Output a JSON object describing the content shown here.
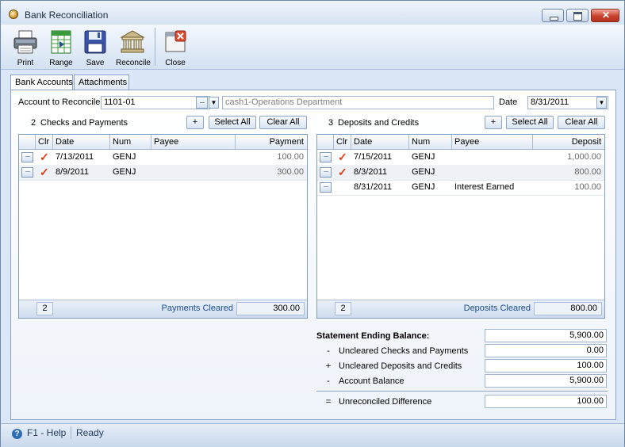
{
  "window": {
    "title": "Bank Reconciliation"
  },
  "toolbar": {
    "print": "Print",
    "range": "Range",
    "save": "Save",
    "reconcile": "Reconcile",
    "close": "Close"
  },
  "tabs": [
    "Bank Accounts",
    "Attachments"
  ],
  "account": {
    "label": "Account to Reconcile",
    "number": "1101-01",
    "description": "cash1-Operations Department",
    "date_label": "Date",
    "date": "8/31/2011"
  },
  "checks": {
    "count": "2",
    "title": "Checks and Payments",
    "add": "+",
    "select_all": "Select All",
    "clear_all": "Clear All",
    "columns": [
      "Clr",
      "Date",
      "Num",
      "Payee",
      "Payment"
    ],
    "rows": [
      {
        "cleared": true,
        "date": "7/13/2011",
        "num": "GENJ",
        "payee": "",
        "amount": "100.00"
      },
      {
        "cleared": true,
        "date": "8/9/2011",
        "num": "GENJ",
        "payee": "",
        "amount": "300.00"
      }
    ],
    "footer_count": "2",
    "footer_label": "Payments Cleared",
    "footer_total": "300.00"
  },
  "deposits": {
    "count": "3",
    "title": "Deposits and Credits",
    "add": "+",
    "select_all": "Select All",
    "clear_all": "Clear All",
    "columns": [
      "Clr",
      "Date",
      "Num",
      "Payee",
      "Deposit"
    ],
    "rows": [
      {
        "cleared": true,
        "date": "7/15/2011",
        "num": "GENJ",
        "payee": "",
        "amount": "1,000.00"
      },
      {
        "cleared": true,
        "date": "8/3/2011",
        "num": "GENJ",
        "payee": "",
        "amount": "800.00"
      },
      {
        "cleared": false,
        "date": "8/31/2011",
        "num": "GENJ",
        "payee": "Interest Earned",
        "amount": "100.00"
      }
    ],
    "footer_count": "2",
    "footer_label": "Deposits Cleared",
    "footer_total": "800.00"
  },
  "summary": {
    "statement_label": "Statement Ending Balance:",
    "statement_value": "5,900.00",
    "uncleared_checks_op": "-",
    "uncleared_checks_label": "Uncleared Checks and Payments",
    "uncleared_checks_value": "0.00",
    "uncleared_deposits_op": "+",
    "uncleared_deposits_label": "Uncleared Deposits and Credits",
    "uncleared_deposits_value": "100.00",
    "account_balance_op": "-",
    "account_balance_label": "Account Balance",
    "account_balance_value": "5,900.00",
    "difference_op": "=",
    "difference_label": "Unreconciled Difference",
    "difference_value": "100.00"
  },
  "status": {
    "help": "F1 - Help",
    "state": "Ready"
  },
  "icons": {
    "check_mark": "✓",
    "row_expand": "···",
    "dropdown": "▼"
  },
  "colors": {
    "check": "#d94010",
    "accent": "#1f4f8f"
  }
}
